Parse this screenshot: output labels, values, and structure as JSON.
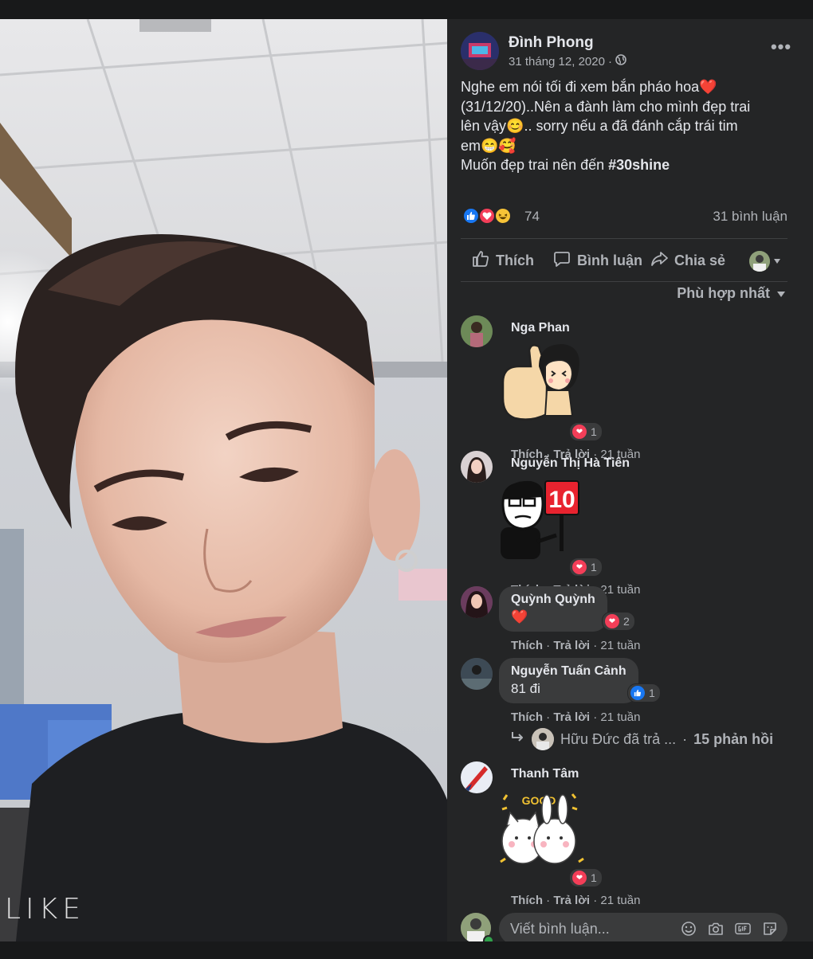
{
  "post": {
    "author": "Đình Phong",
    "date": "31 tháng 12, 2020",
    "date_separator": "·",
    "privacy_icon": "globe-icon",
    "more_label": "•••",
    "text_lines": [
      "Nghe em nói tối đi xem bắn pháo hoa❤️",
      "(31/12/20)..Nên a đành làm cho mình đẹp trai",
      "lên vậy😊.. sorry nếu a đã đánh cắp trái tim",
      "em😁🥰"
    ],
    "text_last_prefix": "Muốn đẹp trai nên đến ",
    "hashtag": "#30shine",
    "reaction_count": "74",
    "comment_count": "31 bình luận",
    "actions": {
      "like": "Thích",
      "comment": "Bình luận",
      "share": "Chia sẻ"
    },
    "sort_label": "Phù hợp nhất"
  },
  "photo": {
    "watermark": "LIKE"
  },
  "comments": [
    {
      "name": "Nga Phan",
      "type": "sticker",
      "sticker": "thumbs-up-girl-sticker",
      "react_count": "1",
      "like": "Thích",
      "reply": "Trả lời",
      "time": "21 tuần"
    },
    {
      "name": "Nguyễn Thị Hà Tiên",
      "type": "sticker",
      "sticker": "score-10-sticker",
      "sticker_text": "10",
      "react_count": "1",
      "like": "Thích",
      "reply": "Trả lời",
      "time": "21 tuần"
    },
    {
      "name": "Quỳnh Quỳnh",
      "type": "text",
      "text": "❤️",
      "react_count": "2",
      "like": "Thích",
      "reply": "Trả lời",
      "time": "21 tuần"
    },
    {
      "name": "Nguyễn Tuấn Cảnh",
      "type": "text",
      "text": "81 đi",
      "react_count": "1",
      "like": "Thích",
      "reply": "Trả lời",
      "time": "21 tuần"
    },
    {
      "name": "Thanh Tâm",
      "type": "sticker",
      "sticker": "good-bunnies-sticker",
      "sticker_text": "GOOD",
      "react_count": "1",
      "like": "Thích",
      "reply": "Trả lời",
      "time": "21 tuần"
    }
  ],
  "reply_summary": {
    "text": "Hữu Đức đã trả ...",
    "separator": "·",
    "count": "15 phản hồi"
  },
  "composer": {
    "placeholder": "Viết bình luận...",
    "icons": [
      "emoji-icon",
      "camera-icon",
      "gif-icon",
      "sticker-icon"
    ]
  },
  "colors": {
    "panel_bg": "#242526",
    "page_bg": "#18191a",
    "bubble_bg": "#3a3b3c",
    "text_primary": "#e4e6eb",
    "text_secondary": "#b0b3b8",
    "like_blue": "#1877f2",
    "love_red": "#f33e58"
  }
}
